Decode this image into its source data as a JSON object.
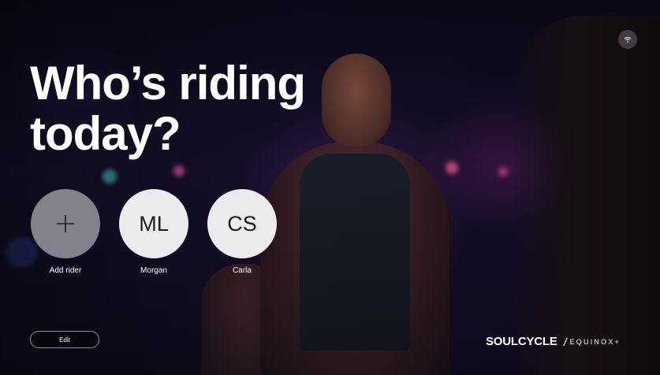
{
  "headline": {
    "line1": "Who’s riding",
    "line2": "today?"
  },
  "profiles": [
    {
      "initials": "+",
      "label": "Add rider",
      "icon": "plus-icon"
    },
    {
      "initials": "ML",
      "label": "Morgan"
    },
    {
      "initials": "CS",
      "label": "Carla"
    }
  ],
  "edit_button": {
    "label": "Edit"
  },
  "status": {
    "wifi_icon": "wifi-icon"
  },
  "brand": {
    "primary": "SOULCYCLE",
    "slash": "/",
    "secondary": "EQUINOX+"
  },
  "colors": {
    "text": "#ffffff",
    "avatar_fill": "#ececef",
    "add_fill": "#969aa0",
    "background": "#120c22"
  }
}
